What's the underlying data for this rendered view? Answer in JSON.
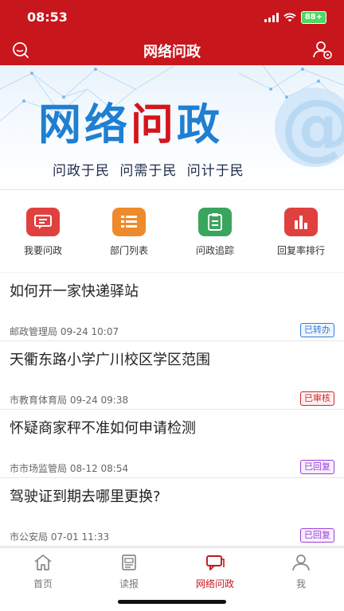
{
  "status": {
    "time": "08:53",
    "battery": "88+"
  },
  "header": {
    "title": "网络问政",
    "left_icon": "search-icon",
    "right_icon": "user-settings-icon",
    "bg_color": "#c8161d"
  },
  "banner": {
    "title_part1": "网络",
    "title_part2": "问",
    "title_part3": "政",
    "slogan": "问政于民 问需于民 问计于民"
  },
  "quick_menu": [
    {
      "label": "我要问政",
      "icon": "message-icon",
      "color": "#e0413f"
    },
    {
      "label": "部门列表",
      "icon": "list-icon",
      "color": "#ee8a2b"
    },
    {
      "label": "问政追踪",
      "icon": "clipboard-icon",
      "color": "#3aa55d"
    },
    {
      "label": "回复率排行",
      "icon": "bar-chart-icon",
      "color": "#e0413f"
    }
  ],
  "questions": [
    {
      "title": "如何开一家快递驿站",
      "dept": "邮政管理局",
      "time": "09-24 10:07",
      "status": "已转办"
    },
    {
      "title": "天衢东路小学广川校区学区范围",
      "dept": "市教育体育局",
      "time": "09-24 09:38",
      "status": "已审核"
    },
    {
      "title": "怀疑商家秤不准如何申请检测",
      "dept": "市市场监管局",
      "time": "08-12 08:54",
      "status": "已回复"
    },
    {
      "title": "驾驶证到期去哪里更换?",
      "dept": "市公安局",
      "time": "07-01 11:33",
      "status": "已回复"
    }
  ],
  "tabs": [
    {
      "label": "首页",
      "icon": "home-icon",
      "active": false
    },
    {
      "label": "读报",
      "icon": "newspaper-icon",
      "active": false
    },
    {
      "label": "网络问政",
      "icon": "chat-icon",
      "active": true
    },
    {
      "label": "我",
      "icon": "user-icon",
      "active": false
    }
  ]
}
